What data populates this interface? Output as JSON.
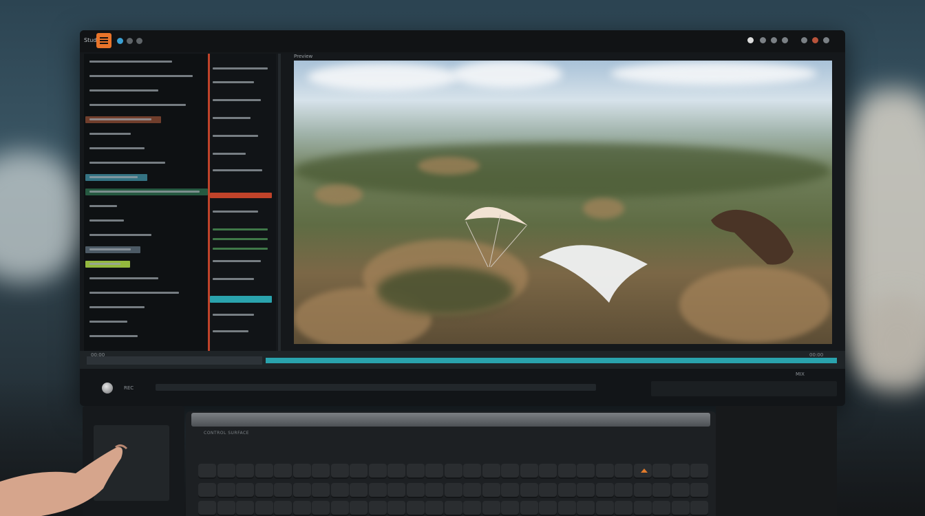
{
  "window": {
    "app_label": "Studio",
    "preview_label": "Preview"
  },
  "sidebar": {
    "rows": [
      {
        "w": 120,
        "hl": null
      },
      {
        "w": 150,
        "hl": null
      },
      {
        "w": 100,
        "hl": null
      },
      {
        "w": 140,
        "hl": null
      },
      {
        "w": 90,
        "hl": "#8a4a33"
      },
      {
        "w": 60,
        "hl": null
      },
      {
        "w": 80,
        "hl": null
      },
      {
        "w": 110,
        "hl": null
      },
      {
        "w": 70,
        "hl": "#3f8ca0"
      },
      {
        "w": 160,
        "hl": "#2d6b4e"
      },
      {
        "w": 40,
        "hl": null
      },
      {
        "w": 50,
        "hl": null
      },
      {
        "w": 90,
        "hl": null
      },
      {
        "w": 60,
        "hl": "#5d6d7a"
      },
      {
        "w": 45,
        "hl": "#b5e24a"
      },
      {
        "w": 100,
        "hl": null
      },
      {
        "w": 130,
        "hl": null
      },
      {
        "w": 80,
        "hl": null
      },
      {
        "w": 55,
        "hl": null
      },
      {
        "w": 70,
        "hl": null
      }
    ]
  },
  "timeline": {
    "start_label": "00:00",
    "end_label": "00:00"
  },
  "controls": {
    "left_label": "REC",
    "right_label": "MIX"
  },
  "keyboard": {
    "brand_text": "CONTROL SURFACE"
  },
  "colors": {
    "accent_orange": "#e8742a",
    "accent_red": "#c0432a",
    "accent_teal": "#2aa3ad",
    "accent_green": "#b5e24a"
  }
}
